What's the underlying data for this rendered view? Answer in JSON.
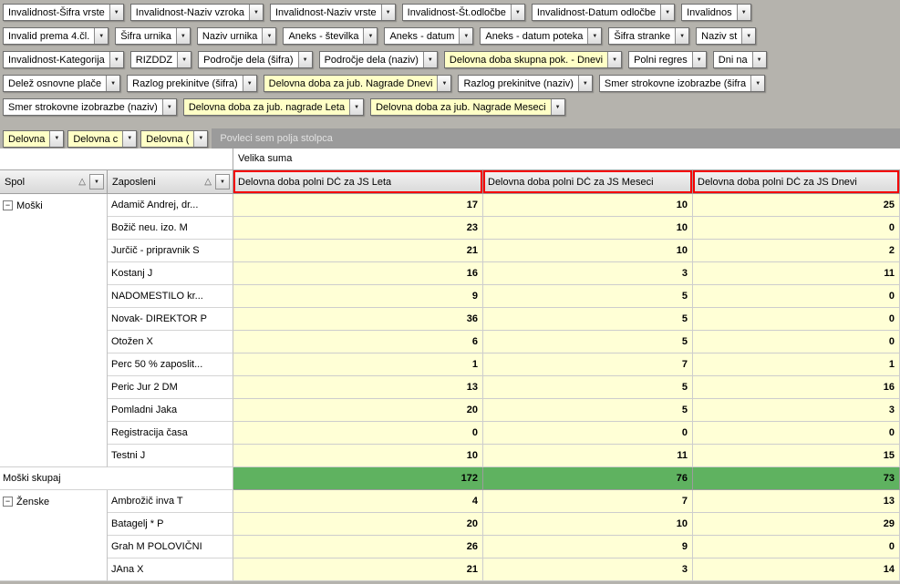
{
  "icons": {
    "dropdown": "▼",
    "sort_ascending": "△",
    "collapse": "−"
  },
  "colors": {
    "field_highlight": "#ffffc6",
    "data_cell_bg": "#ffffd6",
    "total_row_bg": "#5fb260",
    "annotation_red": "#f40000",
    "background_gray": "#b5b3ad"
  },
  "filter_area": {
    "rows": [
      {
        "fields": [
          {
            "label": "Invalidnost-Šifra vrste"
          },
          {
            "label": "Invalidnost-Naziv vzroka"
          },
          {
            "label": "Invalidnost-Naziv vrste"
          },
          {
            "label": "Invalidnost-Št.odločbe"
          },
          {
            "label": "Invalidnost-Datum odločbe"
          },
          {
            "label": "Invalidnos"
          }
        ]
      },
      {
        "fields": [
          {
            "label": "Invalid prema 4.čl."
          },
          {
            "label": "Šifra urnika"
          },
          {
            "label": "Naziv urnika"
          },
          {
            "label": "Aneks - številka"
          },
          {
            "label": "Aneks - datum"
          },
          {
            "label": "Aneks - datum poteka"
          },
          {
            "label": "Šifra stranke"
          },
          {
            "label": "Naziv st"
          }
        ]
      },
      {
        "fields": [
          {
            "label": "Invalidnost-Kategorija"
          },
          {
            "label": "RIZDDZ"
          },
          {
            "label": "Področje dela (šifra)"
          },
          {
            "label": "Področje dela (naziv)"
          },
          {
            "label": "Delovna doba skupna pok. - Dnevi",
            "highlight": true
          },
          {
            "label": "Polni regres"
          },
          {
            "label": "Dni na"
          }
        ]
      },
      {
        "fields": [
          {
            "label": "Delež osnovne plače"
          },
          {
            "label": "Razlog prekinitve (šifra)"
          },
          {
            "label": "Delovna doba za jub. Nagrade Dnevi",
            "highlight": true
          },
          {
            "label": "Razlog prekinitve (naziv)"
          },
          {
            "label": "Smer strokovne izobrazbe (šifra"
          }
        ]
      },
      {
        "fields": [
          {
            "label": "Smer strokovne izobrazbe (naziv)"
          },
          {
            "label": "Delovna doba za jub. nagrade Leta",
            "highlight": true
          },
          {
            "label": "Delovna doba za jub. Nagrade Meseci",
            "highlight": true
          }
        ]
      }
    ]
  },
  "row_fields": {
    "fields": [
      {
        "label": "Delovna",
        "highlight": true
      },
      {
        "label": "Delovna c",
        "highlight": true
      },
      {
        "label": "Delovna (",
        "highlight": true
      }
    ],
    "drop_hint": "Povleci sem polja stolpca"
  },
  "pivot": {
    "grand_total_label": "Velika suma",
    "row_headers": [
      {
        "label": "Spol"
      },
      {
        "label": "Zaposleni"
      }
    ],
    "columns": [
      "Delovna doba polni DČ za JS Leta",
      "Delovna doba polni DČ za JS Meseci",
      "Delovna doba polni DČ za JS Dnevi"
    ],
    "groups": [
      {
        "group": "Moški",
        "rows": [
          [
            "Adamič Andrej, dr...",
            17,
            10,
            25
          ],
          [
            "Božič neu. izo. M",
            23,
            10,
            0
          ],
          [
            "Jurčič - pripravnik S",
            21,
            10,
            2
          ],
          [
            "Kostanj J",
            16,
            3,
            11
          ],
          [
            "NADOMESTILO kr...",
            9,
            5,
            0
          ],
          [
            "Novak- DIREKTOR P",
            36,
            5,
            0
          ],
          [
            "Otožen X",
            6,
            5,
            0
          ],
          [
            "Perc 50 % zaposlit...",
            1,
            7,
            1
          ],
          [
            "Peric Jur 2 DM",
            13,
            5,
            16
          ],
          [
            "Pomladni Jaka",
            20,
            5,
            3
          ],
          [
            "Registracija časa",
            0,
            0,
            0
          ],
          [
            "Testni J",
            10,
            11,
            15
          ]
        ],
        "total": {
          "label": "Moški skupaj",
          "values": [
            172,
            76,
            73
          ]
        }
      },
      {
        "group": "Ženske",
        "rows": [
          [
            "Ambrožič inva T",
            4,
            7,
            13
          ],
          [
            "Batagelj * P",
            20,
            10,
            29
          ],
          [
            "Grah M POLOVIČNI",
            26,
            9,
            0
          ],
          [
            "JAna X",
            21,
            3,
            14
          ]
        ]
      }
    ]
  }
}
